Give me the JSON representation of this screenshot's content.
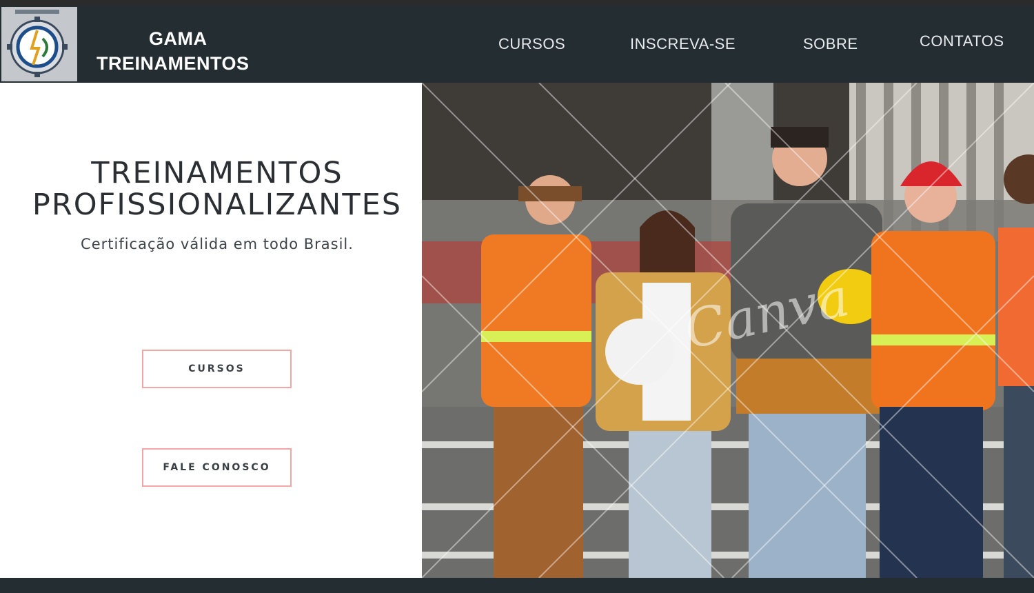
{
  "brand": {
    "line1": "GAMA",
    "line2": "TREINAMENTOS",
    "logo_icon": "company-gear-emblem"
  },
  "nav": {
    "items": [
      {
        "label": "CURSOS"
      },
      {
        "label": "INSCREVA-SE"
      },
      {
        "label": "SOBRE"
      },
      {
        "label": "CONTATOS"
      }
    ]
  },
  "hero": {
    "title_line1": "TREINAMENTOS",
    "title_line2": "PROFISSIONALIZANTES",
    "subtitle": "Certificação válida em todo Brasil.",
    "buttons": {
      "courses": "CURSOS",
      "contact": "FALE CONOSCO"
    }
  },
  "photo": {
    "watermark": "Canva"
  },
  "colors": {
    "nav_bg": "#242d32",
    "nav_text": "#e8ecef",
    "button_border": "#f2a6a6",
    "title_text": "#2b2f33"
  }
}
